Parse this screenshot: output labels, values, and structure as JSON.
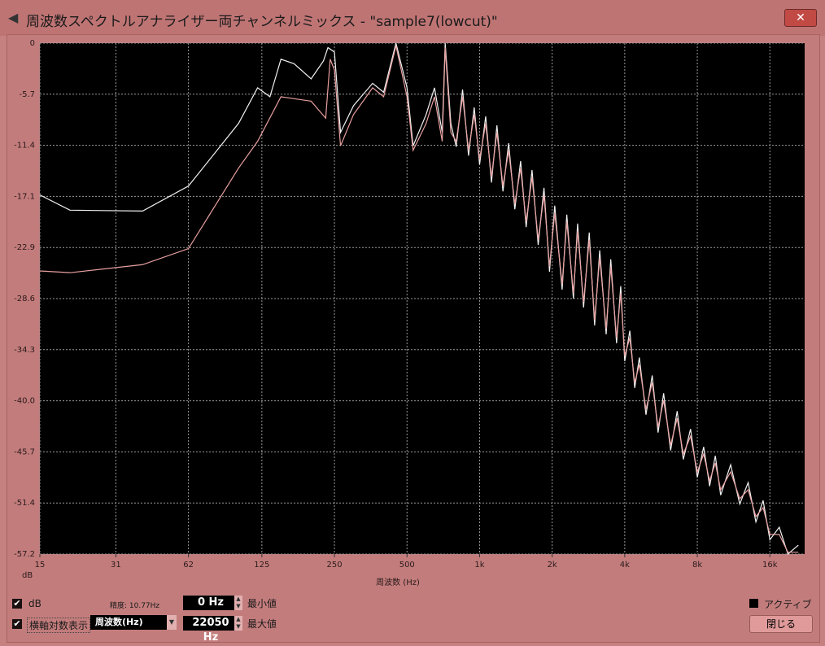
{
  "window": {
    "title": "周波数スペクトルアナライザー両チャンネルミックス - \"sample7(lowcut)\"",
    "close_label": "✕"
  },
  "controls": {
    "db_checkbox_label": "dB",
    "db_checked": true,
    "log_checkbox_label": "横軸対数表示",
    "log_checked": true,
    "precision_label": "精度: 10.77Hz",
    "min_value": "0 Hz",
    "min_label": "最小値",
    "max_value": "22050 Hz",
    "max_label": "最大値",
    "axis_select_value": "周波数(Hz)",
    "active_label": "アクティブ",
    "active_checked": false,
    "close_button": "閉じる"
  },
  "chart_data": {
    "type": "line",
    "xlabel": "周波数 (Hz)",
    "ylabel": "dB",
    "xscale": "log",
    "xlim": [
      15,
      21000
    ],
    "ylim": [
      -57.2,
      0
    ],
    "xticks": [
      15,
      31,
      62,
      125,
      250,
      500,
      1000,
      2000,
      4000,
      8000,
      16000
    ],
    "xtick_labels": [
      "15",
      "31",
      "62",
      "125",
      "250",
      "500",
      "1k",
      "2k",
      "4k",
      "8k",
      "16k"
    ],
    "yticks": [
      "0",
      "-5.7",
      "-11.4",
      "-17.1",
      "-22.9",
      "-28.6",
      "-34.3",
      "-40.0",
      "-45.7",
      "-51.4",
      "-57.2"
    ],
    "grid": true,
    "series": [
      {
        "name": "white",
        "color": "#f2f2f2",
        "points": [
          [
            15,
            -17
          ],
          [
            20,
            -18.7
          ],
          [
            40,
            -18.8
          ],
          [
            62,
            -16
          ],
          [
            100,
            -9
          ],
          [
            120,
            -5
          ],
          [
            135,
            -6
          ],
          [
            150,
            -1.8
          ],
          [
            170,
            -2.3
          ],
          [
            200,
            -4
          ],
          [
            225,
            -2
          ],
          [
            235,
            -0.5
          ],
          [
            250,
            -1
          ],
          [
            265,
            -10
          ],
          [
            300,
            -7
          ],
          [
            360,
            -4.5
          ],
          [
            400,
            -5.5
          ],
          [
            450,
            0
          ],
          [
            500,
            -5
          ],
          [
            530,
            -11.5
          ],
          [
            600,
            -8
          ],
          [
            650,
            -5
          ],
          [
            700,
            -10
          ],
          [
            720,
            0
          ],
          [
            760,
            -9
          ]
        ]
      },
      {
        "name": "pink",
        "color": "#e8a0a0",
        "points": [
          [
            15,
            -25.5
          ],
          [
            20,
            -25.7
          ],
          [
            40,
            -24.8
          ],
          [
            62,
            -23
          ],
          [
            100,
            -14
          ],
          [
            120,
            -11
          ],
          [
            150,
            -6
          ],
          [
            200,
            -6.5
          ],
          [
            230,
            -8.4
          ],
          [
            240,
            -1.8
          ],
          [
            250,
            -3
          ],
          [
            265,
            -11.5
          ],
          [
            300,
            -8
          ],
          [
            360,
            -5
          ],
          [
            400,
            -6
          ],
          [
            450,
            -0.3
          ],
          [
            500,
            -6
          ],
          [
            530,
            -12
          ],
          [
            600,
            -9
          ],
          [
            650,
            -6
          ],
          [
            700,
            -11
          ],
          [
            720,
            -0.5
          ],
          [
            760,
            -10
          ]
        ]
      }
    ],
    "common_tail": [
      [
        800,
        -11
      ],
      [
        850,
        -6
      ],
      [
        900,
        -12
      ],
      [
        950,
        -8
      ],
      [
        1000,
        -13
      ],
      [
        1060,
        -9
      ],
      [
        1120,
        -15
      ],
      [
        1180,
        -10
      ],
      [
        1250,
        -16
      ],
      [
        1320,
        -12
      ],
      [
        1400,
        -18
      ],
      [
        1480,
        -14
      ],
      [
        1560,
        -20
      ],
      [
        1650,
        -15
      ],
      [
        1750,
        -22
      ],
      [
        1850,
        -17
      ],
      [
        1950,
        -25
      ],
      [
        2050,
        -19
      ],
      [
        2200,
        -27
      ],
      [
        2300,
        -20
      ],
      [
        2450,
        -28
      ],
      [
        2550,
        -21
      ],
      [
        2700,
        -29
      ],
      [
        2850,
        -22
      ],
      [
        3000,
        -31
      ],
      [
        3150,
        -24
      ],
      [
        3350,
        -32
      ],
      [
        3500,
        -25
      ],
      [
        3700,
        -33
      ],
      [
        3850,
        -28
      ],
      [
        4000,
        -35
      ],
      [
        4200,
        -33
      ],
      [
        4400,
        -38
      ],
      [
        4600,
        -36
      ],
      [
        4900,
        -41
      ],
      [
        5200,
        -38
      ],
      [
        5500,
        -43
      ],
      [
        5800,
        -40
      ],
      [
        6200,
        -45
      ],
      [
        6600,
        -42
      ],
      [
        7000,
        -46
      ],
      [
        7500,
        -44
      ],
      [
        8000,
        -48
      ],
      [
        8500,
        -46
      ],
      [
        9000,
        -49
      ],
      [
        9500,
        -47
      ],
      [
        10000,
        -50
      ],
      [
        11000,
        -48
      ],
      [
        12000,
        -51
      ],
      [
        13000,
        -50
      ],
      [
        14000,
        -53
      ],
      [
        15000,
        -52
      ],
      [
        16000,
        -55
      ],
      [
        17500,
        -55
      ],
      [
        19000,
        -57
      ],
      [
        21000,
        -57
      ]
    ]
  }
}
